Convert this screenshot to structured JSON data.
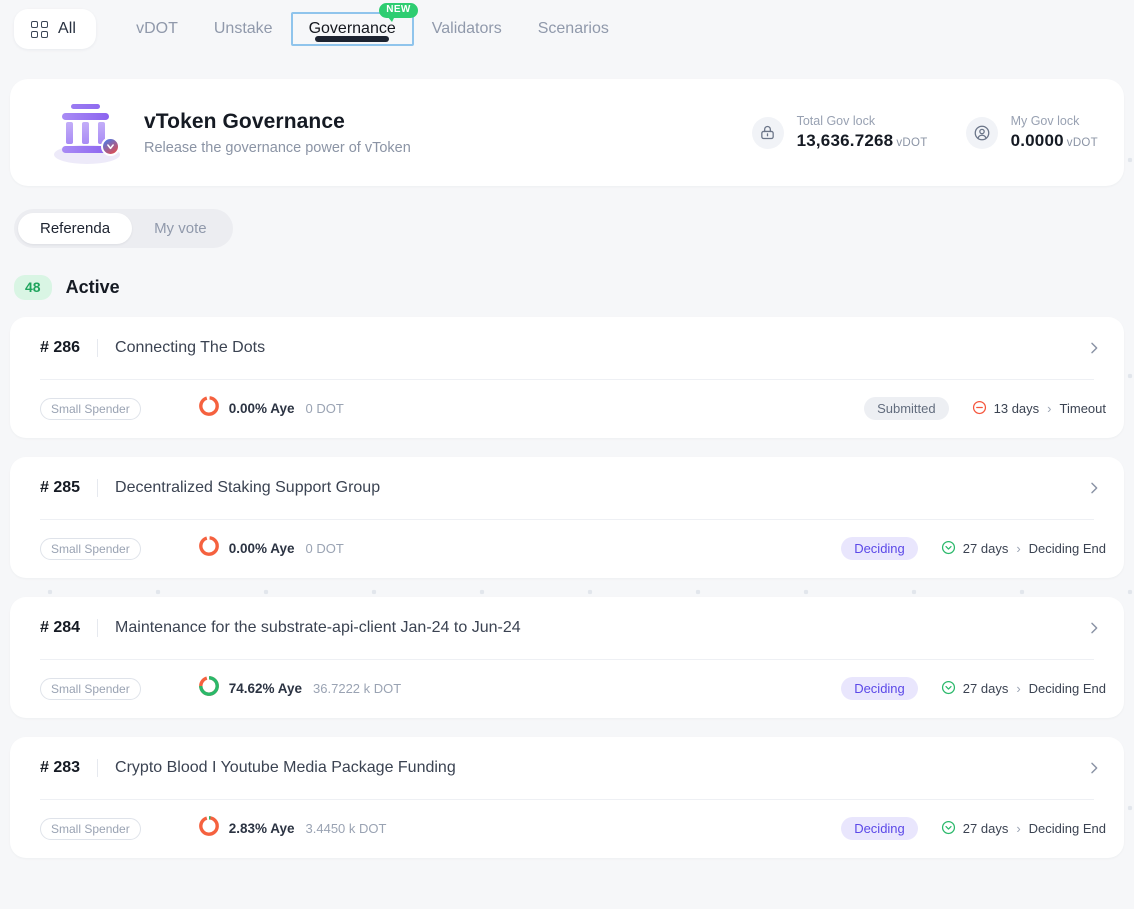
{
  "topnav": {
    "all_button": {
      "label": "All",
      "icon": "grid-icon"
    },
    "tabs": [
      {
        "label": "vDOT",
        "active": false,
        "badge": null
      },
      {
        "label": "Unstake",
        "active": false,
        "badge": null
      },
      {
        "label": "Governance",
        "active": true,
        "badge": "NEW"
      },
      {
        "label": "Validators",
        "active": false,
        "badge": null
      },
      {
        "label": "Scenarios",
        "active": false,
        "badge": null
      }
    ]
  },
  "hero": {
    "icon": "governance-bank-icon",
    "title": "vToken Governance",
    "subtitle": "Release the governance power of vToken",
    "stats": [
      {
        "icon": "lock-icon",
        "label": "Total Gov lock",
        "value": "13,636.7268",
        "unit": "vDOT"
      },
      {
        "icon": "user-icon",
        "label": "My Gov lock",
        "value": "0.0000",
        "unit": "vDOT"
      }
    ]
  },
  "subtabs": [
    {
      "label": "Referenda",
      "active": true
    },
    {
      "label": "My vote",
      "active": false
    }
  ],
  "section": {
    "count": "48",
    "label": "Active"
  },
  "referenda": [
    {
      "number": "# 286",
      "title": "Connecting The Dots",
      "track": "Small Spender",
      "aye_pct_label": "0.00% Aye",
      "aye_pct": 0.0,
      "amount": "0 DOT",
      "status": "Submitted",
      "status_kind": "submitted",
      "timeline_icon": "circle-minus-icon",
      "timeline_icon_color": "#f5563d",
      "time_left": "13 days",
      "time_stage": "Timeout"
    },
    {
      "number": "# 285",
      "title": "Decentralized Staking Support Group",
      "track": "Small Spender",
      "aye_pct_label": "0.00% Aye",
      "aye_pct": 0.0,
      "amount": "0 DOT",
      "status": "Deciding",
      "status_kind": "deciding",
      "timeline_icon": "circle-arrow-icon",
      "timeline_icon_color": "#2ab86a",
      "time_left": "27 days",
      "time_stage": "Deciding End"
    },
    {
      "number": "# 284",
      "title": "Maintenance for the substrate-api-client Jan-24 to Jun-24",
      "track": "Small Spender",
      "aye_pct_label": "74.62% Aye",
      "aye_pct": 74.62,
      "amount": "36.7222 k DOT",
      "status": "Deciding",
      "status_kind": "deciding",
      "timeline_icon": "circle-arrow-icon",
      "timeline_icon_color": "#2ab86a",
      "time_left": "27 days",
      "time_stage": "Deciding End"
    },
    {
      "number": "# 283",
      "title": "Crypto Blood I Youtube Media Package Funding",
      "track": "Small Spender",
      "aye_pct_label": "2.83% Aye",
      "aye_pct": 2.83,
      "amount": "3.4450 k DOT",
      "status": "Deciding",
      "status_kind": "deciding",
      "timeline_icon": "circle-arrow-icon",
      "timeline_icon_color": "#2ab86a",
      "time_left": "27 days",
      "time_stage": "Deciding End"
    }
  ],
  "colors": {
    "aye_green": "#2ab86a",
    "nay_orange": "#f5613f",
    "accent_purple": "#5b48e8",
    "badge_green": "#2ecd71",
    "focus_blue": "#8fc4ec"
  },
  "separator": "›"
}
